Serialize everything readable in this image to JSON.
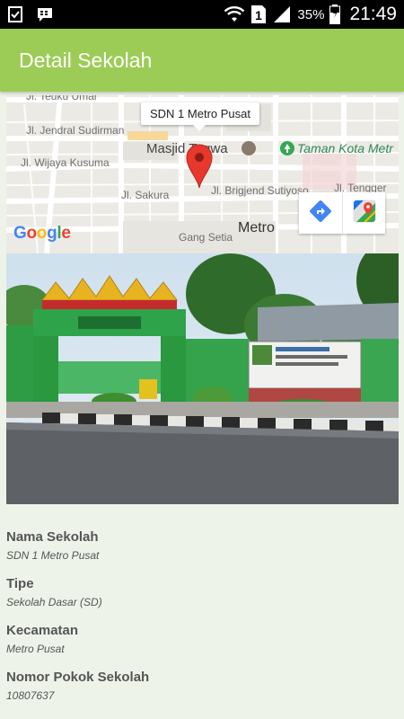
{
  "status_bar": {
    "battery_percent": "35%",
    "time": "21:49",
    "sim_label": "1",
    "icons": [
      "download-check-icon",
      "bbm-icon",
      "wifi-icon",
      "sim-icon",
      "signal-icon",
      "battery-icon"
    ]
  },
  "app_bar": {
    "title": "Detail Sekolah"
  },
  "map": {
    "marker_title": "SDN 1 Metro Pusat",
    "labels": {
      "street1": "Jl. Teuku Umar",
      "street2": "Jl. Jendral Sudirman",
      "street3": "Jl. Wijaya Kusuma",
      "street4": "Jl. Sakura",
      "street5": "Jl. Brigjend Sutiyoso",
      "street6": "Jl. Tengger",
      "street7": "Gang Setia",
      "place1": "Masjid Taqwa",
      "park1": "Taman Kota Metr",
      "city": "Metro"
    },
    "google_logo": [
      "G",
      "o",
      "o",
      "g",
      "l",
      "e"
    ],
    "buttons": [
      "directions-icon",
      "google-maps-icon"
    ]
  },
  "details": [
    {
      "label": "Nama Sekolah",
      "value": "SDN 1 Metro Pusat"
    },
    {
      "label": "Tipe",
      "value": "Sekolah Dasar (SD)"
    },
    {
      "label": "Kecamatan",
      "value": "Metro Pusat"
    },
    {
      "label": "Nomor Pokok Sekolah",
      "value": "10807637"
    }
  ],
  "colors": {
    "app_bar": "#9ccc55",
    "page_background": "#eef3ea",
    "map_pin": "#e8372c"
  }
}
